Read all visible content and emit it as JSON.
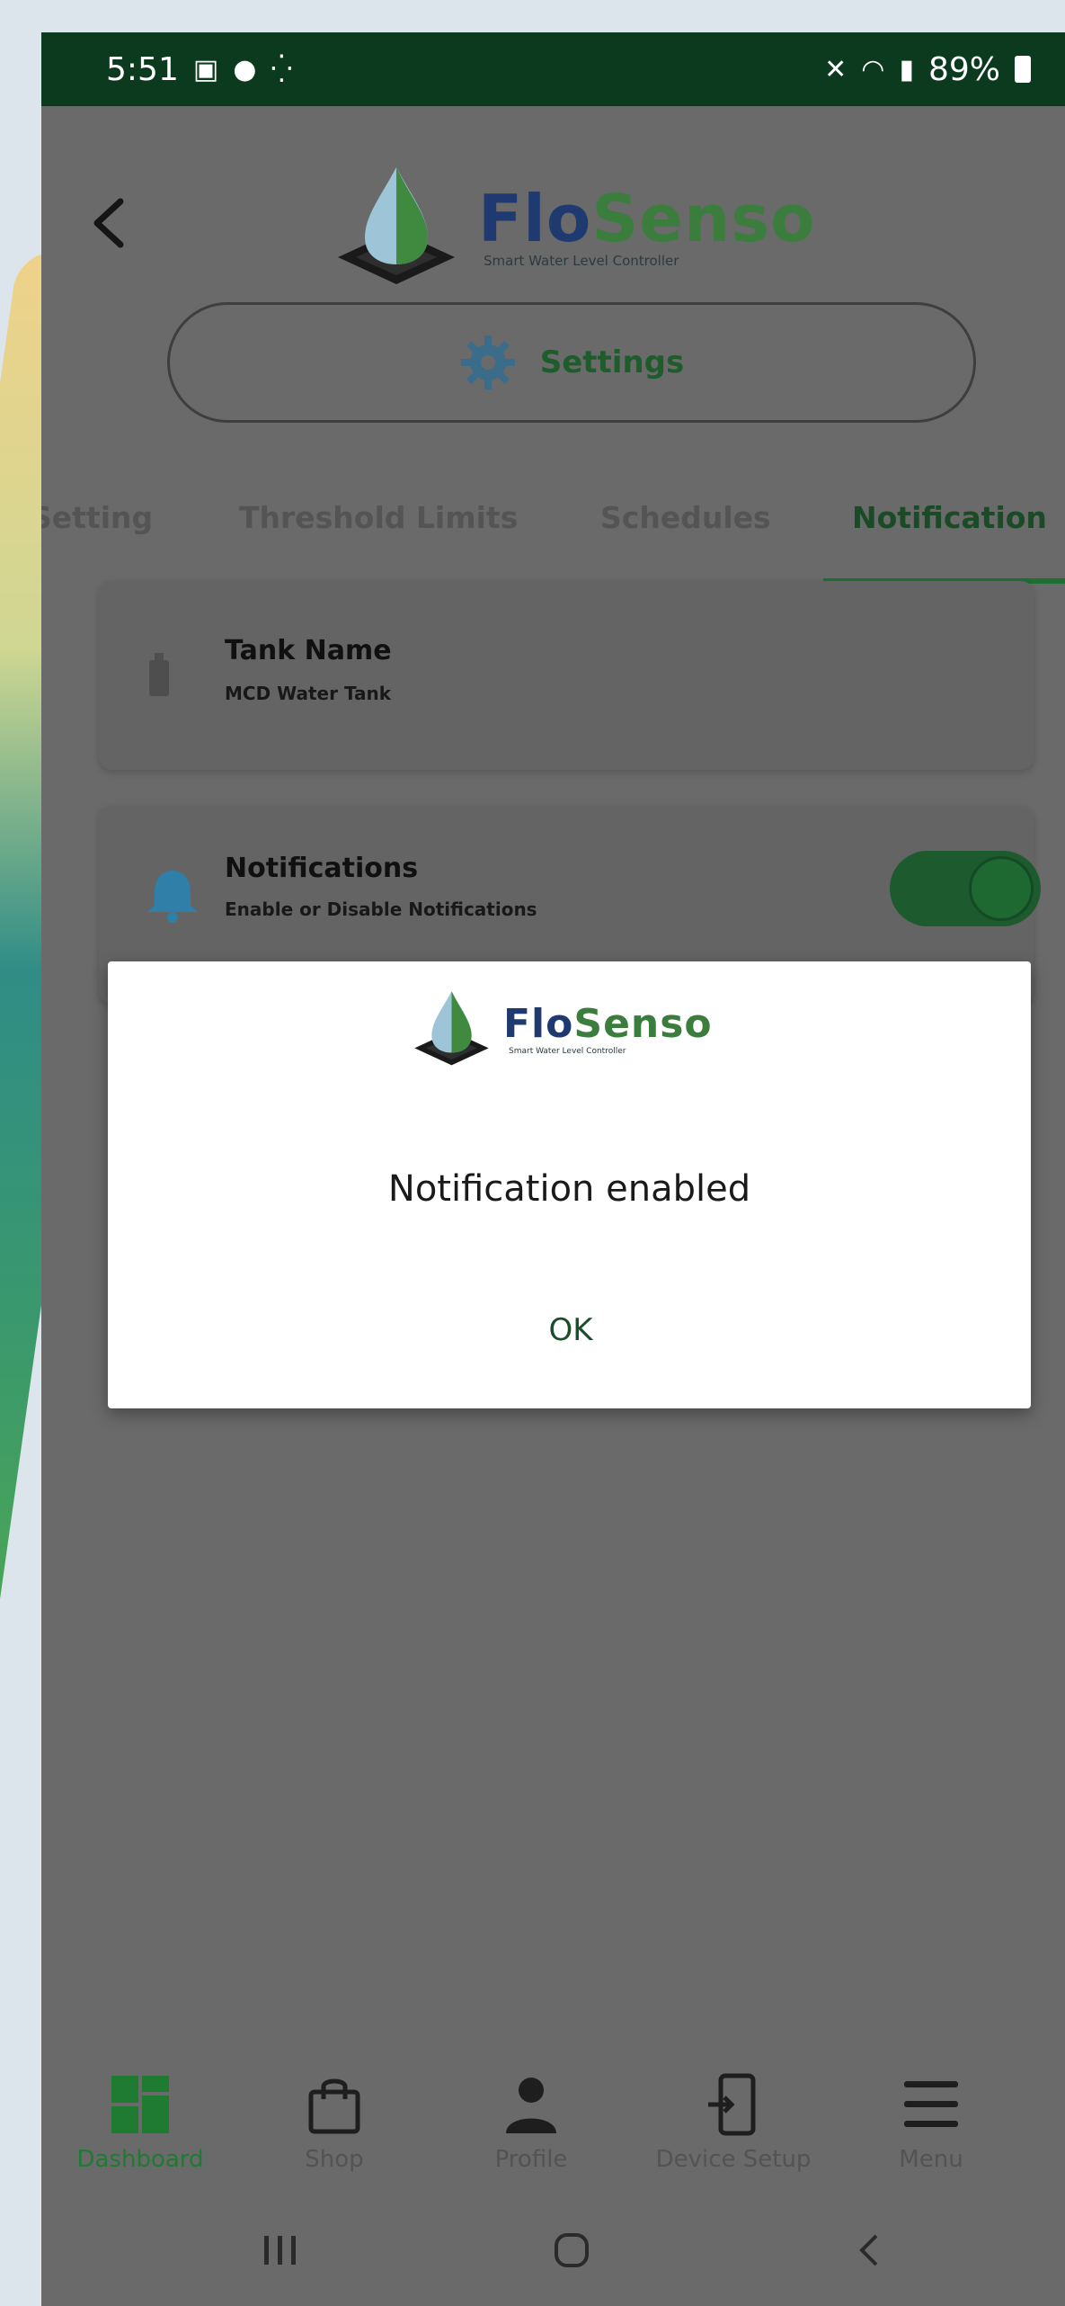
{
  "status_bar": {
    "time": "5:51",
    "left_icons": [
      "gallery-icon",
      "account-icon",
      "vpn-key-icon"
    ],
    "right_icons": [
      "mute-icon",
      "wifi-icon",
      "signal-icon"
    ],
    "battery": "89%"
  },
  "header": {
    "brand_part1": "Flo",
    "brand_part2": "Senso",
    "brand_tagline": "Smart Water Level Controller"
  },
  "settings": {
    "label": "Settings"
  },
  "tabs": [
    {
      "label": "Setting",
      "active": false
    },
    {
      "label": "Threshold Limits",
      "active": false
    },
    {
      "label": "Schedules",
      "active": false
    },
    {
      "label": "Notification",
      "active": true
    }
  ],
  "tank_card": {
    "title": "Tank Name",
    "value": "MCD Water Tank"
  },
  "notifications_card": {
    "title": "Notifications",
    "subtitle": "Enable or Disable Notifications",
    "enabled": true
  },
  "dialog": {
    "brand_part1": "Flo",
    "brand_part2": "Senso",
    "brand_tagline": "Smart Water Level Controller",
    "message": "Notification enabled",
    "ok_label": "OK"
  },
  "bottom_nav": [
    {
      "label": "Dashboard",
      "icon": "dashboard-icon",
      "active": true
    },
    {
      "label": "Shop",
      "icon": "shopping-bag-icon",
      "active": false
    },
    {
      "label": "Profile",
      "icon": "person-icon",
      "active": false
    },
    {
      "label": "Device Setup",
      "icon": "device-setup-icon",
      "active": false
    },
    {
      "label": "Menu",
      "icon": "menu-icon",
      "active": false
    }
  ],
  "system_nav": [
    "recents-icon",
    "home-icon",
    "back-icon"
  ],
  "colors": {
    "status_bar": "#0c3a1e",
    "brand_blue": "#1f3a70",
    "brand_green": "#3b7d3d",
    "overlay": "#6a6a6a",
    "accent_green": "#1f6e32"
  }
}
